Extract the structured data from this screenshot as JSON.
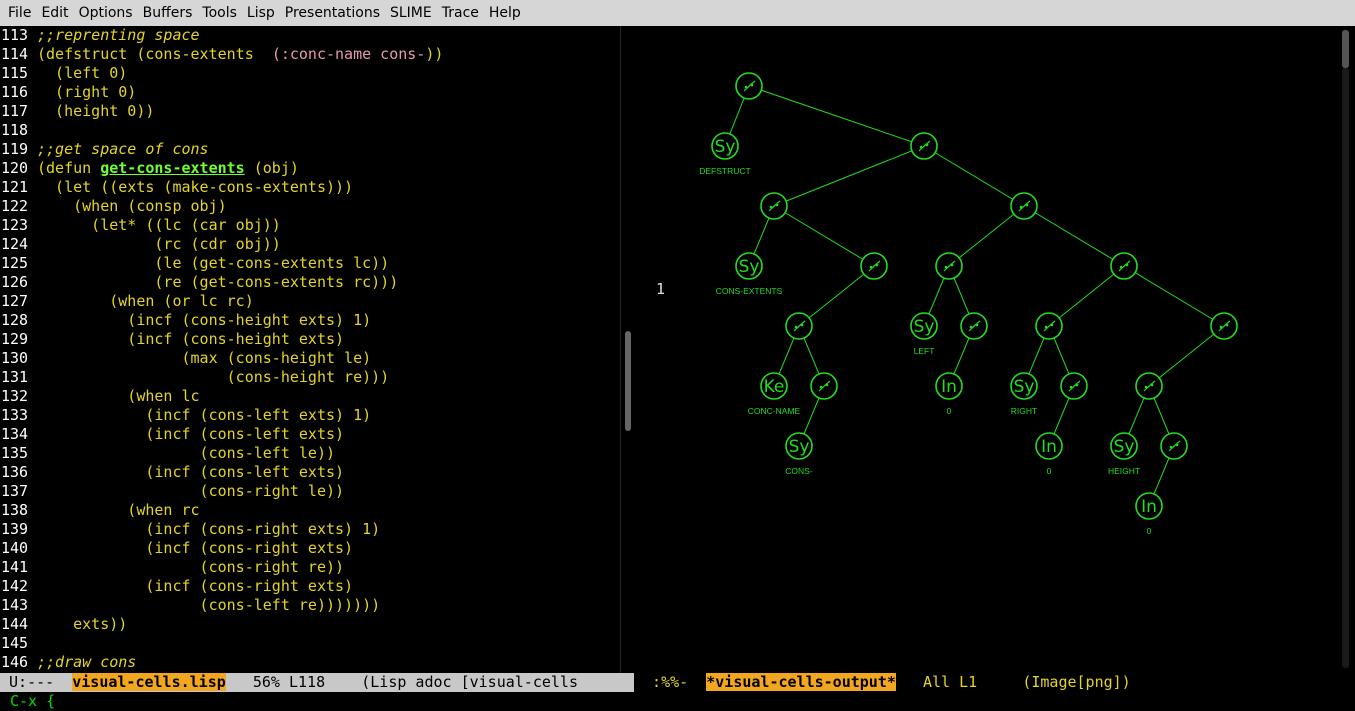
{
  "menubar": {
    "items": [
      "File",
      "Edit",
      "Options",
      "Buffers",
      "Tools",
      "Lisp",
      "Presentations",
      "SLIME",
      "Trace",
      "Help"
    ]
  },
  "editor": {
    "lines": [
      {
        "n": "113",
        "parts": [
          {
            "t": ";;reprenting space",
            "c": "cm"
          }
        ]
      },
      {
        "n": "114",
        "parts": [
          {
            "t": "(defstruct (cons-extents  ",
            "c": "cd"
          },
          {
            "t": "(:conc-name cons-",
            "c": "kw"
          },
          {
            "t": "))",
            "c": "cd"
          }
        ]
      },
      {
        "n": "115",
        "parts": [
          {
            "t": "  (left 0)",
            "c": "cd"
          }
        ]
      },
      {
        "n": "116",
        "parts": [
          {
            "t": "  (right 0)",
            "c": "cd"
          }
        ]
      },
      {
        "n": "117",
        "parts": [
          {
            "t": "  (height 0))",
            "c": "cd"
          }
        ]
      },
      {
        "n": "118",
        "parts": []
      },
      {
        "n": "119",
        "parts": [
          {
            "t": ";;get space of cons",
            "c": "cm"
          }
        ]
      },
      {
        "n": "120",
        "parts": [
          {
            "t": "(defun ",
            "c": "cd"
          },
          {
            "t": "get-cons-extents",
            "c": "fn"
          },
          {
            "t": " (obj)",
            "c": "cd"
          }
        ]
      },
      {
        "n": "121",
        "parts": [
          {
            "t": "  (let ((exts (make-cons-extents)))",
            "c": "cd"
          }
        ]
      },
      {
        "n": "122",
        "parts": [
          {
            "t": "    (when (consp obj)",
            "c": "cd"
          }
        ]
      },
      {
        "n": "123",
        "parts": [
          {
            "t": "      (let* ((lc (car obj))",
            "c": "cd"
          }
        ]
      },
      {
        "n": "124",
        "parts": [
          {
            "t": "             (rc (cdr obj))",
            "c": "cd"
          }
        ]
      },
      {
        "n": "125",
        "parts": [
          {
            "t": "             (le (get-cons-extents lc))",
            "c": "cd"
          }
        ]
      },
      {
        "n": "126",
        "parts": [
          {
            "t": "             (re (get-cons-extents rc)))",
            "c": "cd"
          }
        ]
      },
      {
        "n": "127",
        "parts": [
          {
            "t": "        (when (or lc rc)",
            "c": "cd"
          }
        ]
      },
      {
        "n": "128",
        "parts": [
          {
            "t": "          (incf (cons-height exts) 1)",
            "c": "cd"
          }
        ]
      },
      {
        "n": "129",
        "parts": [
          {
            "t": "          (incf (cons-height exts)",
            "c": "cd"
          }
        ]
      },
      {
        "n": "130",
        "parts": [
          {
            "t": "                (max (cons-height le)",
            "c": "cd"
          }
        ]
      },
      {
        "n": "131",
        "parts": [
          {
            "t": "                     (cons-height re)))",
            "c": "cd"
          }
        ]
      },
      {
        "n": "132",
        "parts": [
          {
            "t": "          (when lc",
            "c": "cd"
          }
        ]
      },
      {
        "n": "133",
        "parts": [
          {
            "t": "            (incf (cons-left exts) 1)",
            "c": "cd"
          }
        ]
      },
      {
        "n": "134",
        "parts": [
          {
            "t": "            (incf (cons-left exts)",
            "c": "cd"
          }
        ]
      },
      {
        "n": "135",
        "parts": [
          {
            "t": "                  (cons-left le))",
            "c": "cd"
          }
        ]
      },
      {
        "n": "136",
        "parts": [
          {
            "t": "            (incf (cons-left exts)",
            "c": "cd"
          }
        ]
      },
      {
        "n": "137",
        "parts": [
          {
            "t": "                  (cons-right le))",
            "c": "cd"
          }
        ]
      },
      {
        "n": "138",
        "parts": [
          {
            "t": "          (when rc",
            "c": "cd"
          }
        ]
      },
      {
        "n": "139",
        "parts": [
          {
            "t": "            (incf (cons-right exts) 1)",
            "c": "cd"
          }
        ]
      },
      {
        "n": "140",
        "parts": [
          {
            "t": "            (incf (cons-right exts)",
            "c": "cd"
          }
        ]
      },
      {
        "n": "141",
        "parts": [
          {
            "t": "                  (cons-right re))",
            "c": "cd"
          }
        ]
      },
      {
        "n": "142",
        "parts": [
          {
            "t": "            (incf (cons-right exts)",
            "c": "cd"
          }
        ]
      },
      {
        "n": "143",
        "parts": [
          {
            "t": "                  (cons-left re)))))))",
            "c": "cd"
          }
        ]
      },
      {
        "n": "144",
        "parts": [
          {
            "t": "    exts))",
            "c": "cd"
          }
        ]
      },
      {
        "n": "145",
        "parts": []
      },
      {
        "n": "146",
        "parts": [
          {
            "t": ";;draw cons",
            "c": "cm"
          }
        ]
      }
    ]
  },
  "output": {
    "marker": "1",
    "tree": {
      "edges": [
        [
          "c0",
          "s1"
        ],
        [
          "c0",
          "c1"
        ],
        [
          "c1",
          "c2"
        ],
        [
          "c1",
          "c3"
        ],
        [
          "c2",
          "s2"
        ],
        [
          "c2",
          "c4"
        ],
        [
          "c4",
          "c5"
        ],
        [
          "c5",
          "k1"
        ],
        [
          "c5",
          "c6"
        ],
        [
          "c6",
          "s3"
        ],
        [
          "c3",
          "c7"
        ],
        [
          "c3",
          "c8"
        ],
        [
          "c7",
          "s4"
        ],
        [
          "c7",
          "c9"
        ],
        [
          "c9",
          "i1"
        ],
        [
          "c8",
          "c10"
        ],
        [
          "c8",
          "c11"
        ],
        [
          "c10",
          "s5"
        ],
        [
          "c10",
          "c12"
        ],
        [
          "c12",
          "i2"
        ],
        [
          "c11",
          "c13"
        ],
        [
          "c13",
          "s6"
        ],
        [
          "c13",
          "c14"
        ],
        [
          "c14",
          "i3"
        ]
      ],
      "nodes": [
        {
          "id": "c0",
          "kind": "cons"
        },
        {
          "id": "s1",
          "kind": "atom",
          "glyph": "Sy",
          "label": "DEFSTRUCT"
        },
        {
          "id": "c1",
          "kind": "cons"
        },
        {
          "id": "c2",
          "kind": "cons"
        },
        {
          "id": "c3",
          "kind": "cons"
        },
        {
          "id": "s2",
          "kind": "atom",
          "glyph": "Sy",
          "label": "CONS-EXTENTS"
        },
        {
          "id": "c4",
          "kind": "cons"
        },
        {
          "id": "c7",
          "kind": "cons"
        },
        {
          "id": "c8",
          "kind": "cons"
        },
        {
          "id": "c5",
          "kind": "cons"
        },
        {
          "id": "s4",
          "kind": "atom",
          "glyph": "Sy",
          "label": "LEFT"
        },
        {
          "id": "c9",
          "kind": "cons"
        },
        {
          "id": "c10",
          "kind": "cons"
        },
        {
          "id": "c11",
          "kind": "cons"
        },
        {
          "id": "k1",
          "kind": "atom",
          "glyph": "Ke",
          "label": "CONC-NAME"
        },
        {
          "id": "c6",
          "kind": "cons"
        },
        {
          "id": "i1",
          "kind": "atom",
          "glyph": "In",
          "label": "0"
        },
        {
          "id": "s5",
          "kind": "atom",
          "glyph": "Sy",
          "label": "RIGHT"
        },
        {
          "id": "c12",
          "kind": "cons"
        },
        {
          "id": "c13",
          "kind": "cons"
        },
        {
          "id": "s3",
          "kind": "atom",
          "glyph": "Sy",
          "label": "CONS-"
        },
        {
          "id": "i2",
          "kind": "atom",
          "glyph": "In",
          "label": "0"
        },
        {
          "id": "s6",
          "kind": "atom",
          "glyph": "Sy",
          "label": "HEIGHT"
        },
        {
          "id": "c14",
          "kind": "cons"
        },
        {
          "id": "i3",
          "kind": "atom",
          "glyph": "In",
          "label": "0"
        }
      ]
    }
  },
  "modeline_left": {
    "status": " U:---  ",
    "buffer": "visual-cells.lisp",
    "position": "   56% L118    ",
    "mode": "(Lisp adoc [visual-cells"
  },
  "modeline_right": {
    "status": "  :%%-  ",
    "buffer": "*visual-cells-output*",
    "position": "   All L1     ",
    "mode": "(Image[png])"
  },
  "echo": {
    "text": "C-x {"
  },
  "colors": {
    "tree": "#22dd22",
    "menubar": "#d6d6d6",
    "buffer_highlight": "#f3a61f"
  }
}
